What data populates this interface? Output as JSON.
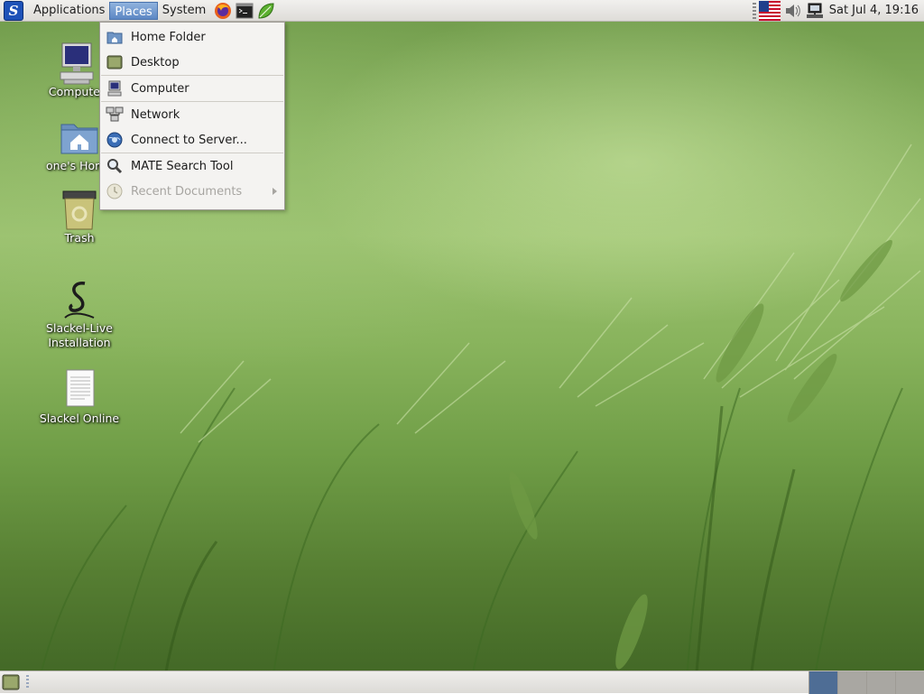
{
  "top_panel": {
    "logo_icon": "slackware-logo-icon",
    "menus": [
      {
        "label": "Applications",
        "active": false
      },
      {
        "label": "Places",
        "active": true
      },
      {
        "label": "System",
        "active": false
      }
    ],
    "launchers": [
      "firefox-icon",
      "terminal-icon",
      "text-editor-leaf-icon"
    ],
    "tray": [
      "us-flag-keyboard-layout-icon",
      "volume-icon",
      "network-icon"
    ],
    "clock": "Sat Jul  4, 19:16"
  },
  "places_menu": {
    "items": [
      {
        "label": "Home Folder",
        "icon": "home-folder-icon",
        "enabled": true
      },
      {
        "label": "Desktop",
        "icon": "desktop-icon",
        "enabled": true
      },
      {
        "label": "Computer",
        "icon": "computer-icon",
        "enabled": true
      },
      {
        "label": "Network",
        "icon": "network-icon",
        "enabled": true
      },
      {
        "label": "Connect to Server...",
        "icon": "connect-server-icon",
        "enabled": true
      },
      {
        "label": "MATE Search Tool",
        "icon": "search-icon",
        "enabled": true
      },
      {
        "label": "Recent Documents",
        "icon": "recent-documents-icon",
        "enabled": false,
        "has_submenu": true
      }
    ]
  },
  "desktop_icons": [
    {
      "label": "Computer",
      "icon": "computer-icon"
    },
    {
      "label": "one's Home",
      "icon": "home-folder-icon"
    },
    {
      "label": "Trash",
      "icon": "trash-icon"
    },
    {
      "label": "Slackel-Live Installation",
      "line1": "Slackel-Live",
      "line2": "Installation",
      "icon": "slackel-installer-icon"
    },
    {
      "label": "Slackel Online",
      "icon": "document-icon"
    }
  ],
  "bottom_panel": {
    "show_desktop_icon": "show-desktop-icon",
    "workspaces": [
      {
        "index": 1,
        "active": true
      },
      {
        "index": 2,
        "active": false
      },
      {
        "index": 3,
        "active": false
      },
      {
        "index": 4,
        "active": false
      }
    ]
  },
  "colors": {
    "menu_active": "#5d87c4",
    "workspace_active": "#4e6d95",
    "panel_bg": "#e6e4e0"
  }
}
